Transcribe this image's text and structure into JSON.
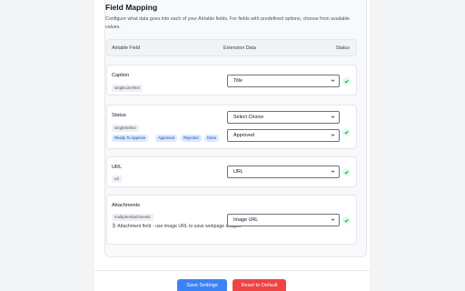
{
  "page": {
    "title": "Field Mapping",
    "description": "Configure what data goes into each of your Airtable fields. For fields with predefined options, choose from available values."
  },
  "table": {
    "headers": {
      "airtable_field": "Airtable Field",
      "extension_data": "Extension Data",
      "status": "Status"
    }
  },
  "fields": [
    {
      "name": "Caption",
      "type": "singleLineText",
      "selected": "Title",
      "status_icon": "check-icon"
    },
    {
      "name": "Status",
      "type": "singleSelect",
      "options": [
        "Ready To Approve",
        "Approved",
        "Rejected",
        "Done"
      ],
      "selected": "Select Choice",
      "selected_secondary": "Approved",
      "status_icon": "check-icon"
    },
    {
      "name": "URL",
      "type": "url",
      "selected": "URL",
      "status_icon": "check-icon"
    },
    {
      "name": "Attachments",
      "type": "multipleAttachments",
      "note": "Attachment field - use image URL to save webpage images",
      "note_icon": "paperclip-icon",
      "selected": "Image URL",
      "status_icon": "check-icon"
    }
  ],
  "buttons": {
    "save": "Save Settings",
    "reset": "Reset to Default"
  },
  "colors": {
    "save": "#3b82f6",
    "reset": "#ef4444",
    "success": "#16a34a",
    "chip_bg": "#dbeafe"
  }
}
